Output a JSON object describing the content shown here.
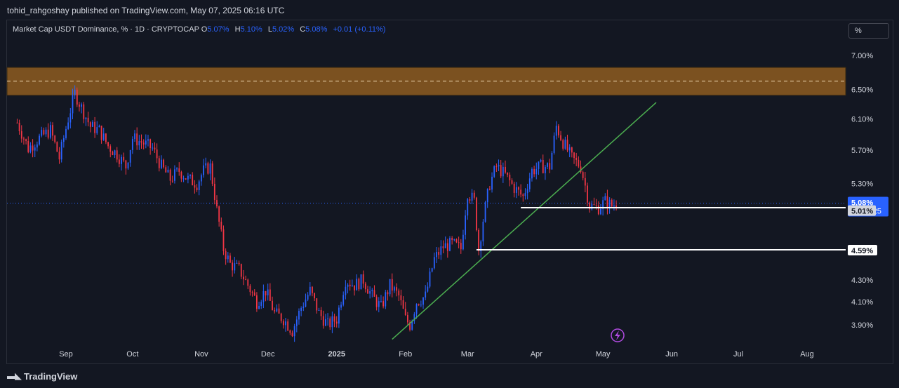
{
  "header": {
    "publisher_text": "tohid_rahgoshay published on TradingView.com, May 07, 2025 06:16 UTC"
  },
  "legend": {
    "symbol": "Market Cap USDT Dominance, % · 1D · CRYPTOCAP",
    "o_label": "O",
    "o_value": "5.07%",
    "h_label": "H",
    "h_value": "5.10%",
    "l_label": "L",
    "l_value": "5.02%",
    "c_label": "C",
    "c_value": "5.08%",
    "change": "+0.01 (+0.11%)"
  },
  "scale_button": "%",
  "footer": {
    "brand": "TradingView"
  },
  "colors": {
    "up": "#2962ff",
    "down": "#f23645",
    "zone": "#7b5120",
    "trend": "#4caf50",
    "bg": "#131722"
  },
  "chart_data": {
    "type": "candlestick",
    "y_scale": "log",
    "y_tick_labels": [
      "7.00%",
      "6.50%",
      "6.10%",
      "5.70%",
      "5.30%",
      "4.30%",
      "4.10%",
      "3.90%"
    ],
    "y_ticks": [
      7.0,
      6.5,
      6.1,
      5.7,
      5.3,
      4.3,
      4.1,
      3.9
    ],
    "x_tick_labels": [
      {
        "label": "Sep",
        "date": "2024-09-01",
        "bold": false
      },
      {
        "label": "Oct",
        "date": "2024-10-01",
        "bold": false
      },
      {
        "label": "Nov",
        "date": "2024-11-01",
        "bold": false
      },
      {
        "label": "Dec",
        "date": "2024-12-01",
        "bold": false
      },
      {
        "label": "2025",
        "date": "2025-01-01",
        "bold": true
      },
      {
        "label": "Feb",
        "date": "2025-02-01",
        "bold": false
      },
      {
        "label": "Mar",
        "date": "2025-03-01",
        "bold": false
      },
      {
        "label": "Apr",
        "date": "2025-04-01",
        "bold": false
      },
      {
        "label": "May",
        "date": "2025-05-01",
        "bold": false
      },
      {
        "label": "Jun",
        "date": "2025-06-01",
        "bold": false
      },
      {
        "label": "Jul",
        "date": "2025-07-01",
        "bold": false
      },
      {
        "label": "Aug",
        "date": "2025-08-01",
        "bold": false
      }
    ],
    "price_series": [
      [
        "2024-08-10",
        6.05
      ],
      [
        "2024-08-15",
        5.72
      ],
      [
        "2024-08-20",
        5.85
      ],
      [
        "2024-08-25",
        5.95
      ],
      [
        "2024-08-29",
        5.6
      ],
      [
        "2024-09-02",
        6.1
      ],
      [
        "2024-09-05",
        6.45
      ],
      [
        "2024-09-08",
        6.25
      ],
      [
        "2024-09-12",
        6.0
      ],
      [
        "2024-09-16",
        5.95
      ],
      [
        "2024-09-20",
        5.75
      ],
      [
        "2024-09-24",
        5.65
      ],
      [
        "2024-09-28",
        5.5
      ],
      [
        "2024-10-01",
        5.85
      ],
      [
        "2024-10-05",
        5.8
      ],
      [
        "2024-10-10",
        5.72
      ],
      [
        "2024-10-14",
        5.5
      ],
      [
        "2024-10-18",
        5.35
      ],
      [
        "2024-10-22",
        5.45
      ],
      [
        "2024-10-26",
        5.35
      ],
      [
        "2024-10-30",
        5.3
      ],
      [
        "2024-11-02",
        5.45
      ],
      [
        "2024-11-05",
        5.5
      ],
      [
        "2024-11-08",
        5.0
      ],
      [
        "2024-11-11",
        4.6
      ],
      [
        "2024-11-14",
        4.45
      ],
      [
        "2024-11-18",
        4.4
      ],
      [
        "2024-11-22",
        4.25
      ],
      [
        "2024-11-26",
        4.1
      ],
      [
        "2024-11-30",
        4.2
      ],
      [
        "2024-12-04",
        4.0
      ],
      [
        "2024-12-08",
        3.95
      ],
      [
        "2024-12-12",
        3.85
      ],
      [
        "2024-12-16",
        4.05
      ],
      [
        "2024-12-20",
        4.2
      ],
      [
        "2024-12-24",
        4.0
      ],
      [
        "2024-12-28",
        3.9
      ],
      [
        "2025-01-01",
        3.95
      ],
      [
        "2025-01-05",
        4.3
      ],
      [
        "2025-01-09",
        4.25
      ],
      [
        "2025-01-13",
        4.3
      ],
      [
        "2025-01-17",
        4.15
      ],
      [
        "2025-01-21",
        4.05
      ],
      [
        "2025-01-25",
        4.25
      ],
      [
        "2025-01-29",
        4.15
      ],
      [
        "2025-02-01",
        3.95
      ],
      [
        "2025-02-03",
        3.9
      ],
      [
        "2025-02-06",
        4.1
      ],
      [
        "2025-02-10",
        4.15
      ],
      [
        "2025-02-14",
        4.5
      ],
      [
        "2025-02-18",
        4.62
      ],
      [
        "2025-02-22",
        4.65
      ],
      [
        "2025-02-26",
        4.6
      ],
      [
        "2025-03-01",
        5.2
      ],
      [
        "2025-03-04",
        5.1
      ],
      [
        "2025-03-06",
        4.59
      ],
      [
        "2025-03-08",
        4.9
      ],
      [
        "2025-03-11",
        5.3
      ],
      [
        "2025-03-14",
        5.5
      ],
      [
        "2025-03-18",
        5.4
      ],
      [
        "2025-03-22",
        5.25
      ],
      [
        "2025-03-26",
        5.15
      ],
      [
        "2025-03-30",
        5.45
      ],
      [
        "2025-04-03",
        5.5
      ],
      [
        "2025-04-07",
        5.5
      ],
      [
        "2025-04-10",
        6.0
      ],
      [
        "2025-04-13",
        5.8
      ],
      [
        "2025-04-17",
        5.6
      ],
      [
        "2025-04-21",
        5.5
      ],
      [
        "2025-04-25",
        5.05
      ],
      [
        "2025-04-29",
        5.03
      ],
      [
        "2025-05-02",
        5.1
      ],
      [
        "2025-05-05",
        5.05
      ],
      [
        "2025-05-07",
        5.08
      ]
    ],
    "supply_zone": {
      "top": 6.82,
      "bottom": 6.42,
      "mid": 6.62
    },
    "trendline": {
      "from": [
        "2025-01-26",
        3.78
      ],
      "to": [
        "2025-05-25",
        6.32
      ]
    },
    "support_lines": [
      {
        "from": "2025-03-25",
        "value": 5.03
      },
      {
        "from": "2025-03-05",
        "value": 4.59
      }
    ],
    "price_labels": [
      {
        "text": "5.08%",
        "sub": "17:43:25",
        "value": 5.08,
        "style": "current"
      },
      {
        "text": "5.01%",
        "value": 5.01,
        "style": "gray"
      },
      {
        "text": "4.59%",
        "value": 4.59,
        "style": "white"
      }
    ],
    "last_price": 5.08
  }
}
